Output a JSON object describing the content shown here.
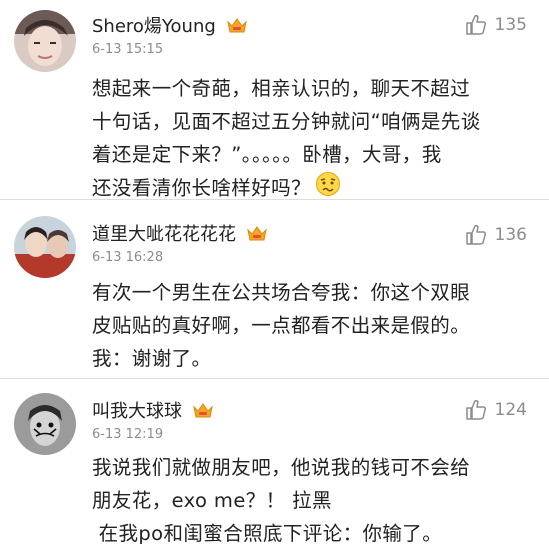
{
  "comments": [
    {
      "username": "Shero煬Young",
      "timestamp": "6-13 15:15",
      "likes": "135",
      "body": [
        "想起来一个奇葩，相亲认识的，聊天不超过",
        "十句话，见面不超过五分钟就问“咱俩是先谈",
        "着还是定下来？”。。。。。卧槽，大哥，我",
        "还没看清你长啥样好吗？"
      ],
      "emoji": "confused-face-emoji"
    },
    {
      "username": "道里大呲花花花花",
      "timestamp": "6-13 16:28",
      "likes": "136",
      "body": [
        "有次一个男生在公共场合夸我：你这个双眼",
        "皮贴贴的真好啊，一点都看不出来是假的。",
        "我：谢谢了。"
      ]
    },
    {
      "username": "叫我大球球",
      "timestamp": "6-13 12:19",
      "likes": "124",
      "body": [
        "我说我们就做朋友吧，他说我的钱可不会给",
        "朋友花，exo me？！ 拉黑",
        " 在我po和闺蜜合照底下评论：你输了。"
      ]
    }
  ],
  "colors": {
    "username": "#222222",
    "timestamp": "#8c8c8c",
    "badge": "#f5a623",
    "divider": "#dedede"
  }
}
